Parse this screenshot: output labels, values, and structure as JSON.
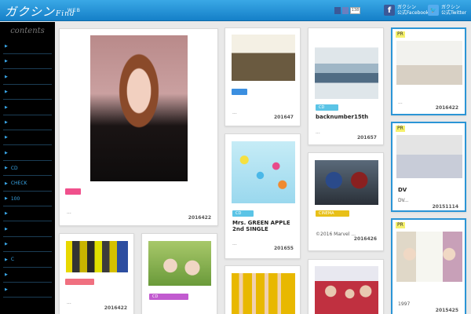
{
  "header": {
    "logo_main": "ガクシン",
    "logo_find": "Find",
    "logo_sub": "WEB",
    "like_count": "138",
    "facebook_label_line1": "ガクシン",
    "facebook_label_line2": "公式Facebook",
    "twitter_label_line1": "ガクシン",
    "twitter_label_line2": "公式Twitter"
  },
  "sidebar": {
    "title": "contents",
    "items": [
      {
        "label": ""
      },
      {
        "label": ""
      },
      {
        "label": ""
      },
      {
        "label": ""
      },
      {
        "label": ""
      },
      {
        "label": ""
      },
      {
        "label": ""
      },
      {
        "label": ""
      },
      {
        "label": "CD"
      },
      {
        "label": "CHECK"
      },
      {
        "label": "100"
      },
      {
        "label": ""
      },
      {
        "label": ""
      },
      {
        "label": ""
      },
      {
        "label": "C"
      },
      {
        "label": ""
      },
      {
        "label": ""
      }
    ]
  },
  "cards": {
    "c1": {
      "dots": "...",
      "date": "2016422"
    },
    "c2": {
      "dots": "...",
      "date": "201647"
    },
    "c3": {
      "tag": "CD",
      "title": "backnumber15th",
      "dots": "...",
      "date": "201657"
    },
    "c4": {
      "tag": "CD",
      "title_line1": "Mrs. GREEN APPLE",
      "title_line2": "2nd SINGLE",
      "dots": "...",
      "date": "201655"
    },
    "c5": {
      "tag": "CINEMA",
      "text": "©2016 Marvel ...",
      "date": "2016426"
    },
    "c6": {
      "dots": "...",
      "date": "2016422"
    },
    "c7": {
      "tag": "CD"
    },
    "pr1": {
      "badge": "PR",
      "dots": "...",
      "date": "2016422"
    },
    "pr2": {
      "badge": "PR",
      "title": "DV",
      "text": "DV...",
      "date": "20151114"
    },
    "pr3": {
      "badge": "PR",
      "text": "1997",
      "date": "2015425"
    }
  },
  "colors": {
    "header": "#1e8fd6",
    "tag_pink": "#f0508c",
    "tag_blue": "#3b8fe0",
    "tag_cyan": "#5bc4e6",
    "tag_yellow": "#e8c018",
    "tag_purple": "#c25bd0",
    "tag_salmon": "#f07080",
    "pr_border": "#2b95d6"
  }
}
